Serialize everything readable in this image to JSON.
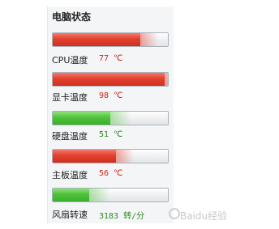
{
  "title": "电脑状态",
  "rows": [
    {
      "label": "CPU温度",
      "value": "77 ℃",
      "level": 0.76,
      "color": "red"
    },
    {
      "label": "显卡温度",
      "value": "98 ℃",
      "level": 0.97,
      "color": "red"
    },
    {
      "label": "硬盘温度",
      "value": "51 ℃",
      "level": 0.5,
      "color": "green"
    },
    {
      "label": "主板温度",
      "value": "56 ℃",
      "level": 0.55,
      "color": "red"
    },
    {
      "label": "风扇转速",
      "value": "3183 转/分",
      "level": 0.32,
      "color": "green"
    }
  ],
  "watermark": "Baidu经验"
}
